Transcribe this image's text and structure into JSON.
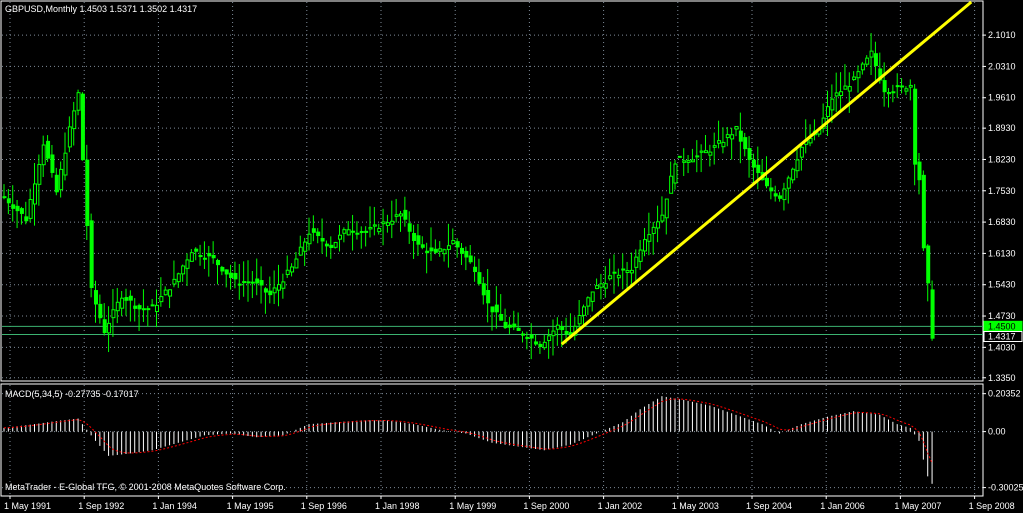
{
  "chart_data": [
    {
      "type": "candlestick",
      "title": "GBPUSD,Monthly  1.4503 1.5371 1.3502 1.4317",
      "y_ticks": [
        "2.1010",
        "2.0310",
        "1.9610",
        "1.8930",
        "1.8230",
        "1.7530",
        "1.6830",
        "1.6130",
        "1.5430",
        "1.4730",
        "1.4030",
        "1.3350"
      ],
      "y_tick_values": [
        2.101,
        2.031,
        1.961,
        1.893,
        1.823,
        1.753,
        1.683,
        1.613,
        1.543,
        1.473,
        1.403,
        1.335
      ],
      "ylim": [
        1.33,
        2.175
      ],
      "x_ticks": [
        "1 May 1991",
        "1 Sep 1992",
        "1 Jan 1994",
        "1 May 1995",
        "1 Sep 1996",
        "1 Jan 1998",
        "1 May 1999",
        "1 Sep 2000",
        "1 Jan 2002",
        "1 May 2003",
        "1 Sep 2004",
        "1 Jan 2006",
        "1 May 2007",
        "1 Sep 2008"
      ],
      "price_labels": [
        {
          "text": "1.4500",
          "value": 1.45,
          "color": "#00ff00"
        },
        {
          "text": "1.4317",
          "value": 1.4317,
          "color": "#ffffff"
        }
      ],
      "horizontal_lines": [
        {
          "value": 1.45,
          "color": "#3cb371"
        },
        {
          "value": 1.4317,
          "color": "#3cb371"
        }
      ],
      "trendline": {
        "from": {
          "date": "2001-11",
          "value": 1.41
        },
        "to": {
          "date": "2009-09",
          "value": 2.175
        },
        "color": "#ffff00"
      },
      "close_series": [
        {
          "date": "1991-03",
          "value": 1.74
        },
        {
          "date": "1991-08",
          "value": 1.69
        },
        {
          "date": "1991-12",
          "value": 1.86
        },
        {
          "date": "1992-03",
          "value": 1.75
        },
        {
          "date": "1992-06",
          "value": 1.89
        },
        {
          "date": "1992-08",
          "value": 1.97
        },
        {
          "date": "1992-11",
          "value": 1.53
        },
        {
          "date": "1993-02",
          "value": 1.44
        },
        {
          "date": "1993-06",
          "value": 1.52
        },
        {
          "date": "1993-10",
          "value": 1.49
        },
        {
          "date": "1994-01",
          "value": 1.49
        },
        {
          "date": "1994-06",
          "value": 1.55
        },
        {
          "date": "1994-10",
          "value": 1.62
        },
        {
          "date": "1995-03",
          "value": 1.6
        },
        {
          "date": "1995-08",
          "value": 1.55
        },
        {
          "date": "1995-12",
          "value": 1.55
        },
        {
          "date": "1996-04",
          "value": 1.52
        },
        {
          "date": "1996-09",
          "value": 1.58
        },
        {
          "date": "1997-01",
          "value": 1.66
        },
        {
          "date": "1997-06",
          "value": 1.63
        },
        {
          "date": "1997-10",
          "value": 1.67
        },
        {
          "date": "1998-02",
          "value": 1.66
        },
        {
          "date": "1998-06",
          "value": 1.68
        },
        {
          "date": "1998-10",
          "value": 1.7
        },
        {
          "date": "1999-02",
          "value": 1.63
        },
        {
          "date": "1999-06",
          "value": 1.61
        },
        {
          "date": "1999-10",
          "value": 1.64
        },
        {
          "date": "2000-03",
          "value": 1.58
        },
        {
          "date": "2000-06",
          "value": 1.5
        },
        {
          "date": "2000-10",
          "value": 1.45
        },
        {
          "date": "2001-03",
          "value": 1.43
        },
        {
          "date": "2001-06",
          "value": 1.41
        },
        {
          "date": "2001-10",
          "value": 1.45
        },
        {
          "date": "2002-01",
          "value": 1.43
        },
        {
          "date": "2002-06",
          "value": 1.53
        },
        {
          "date": "2002-10",
          "value": 1.56
        },
        {
          "date": "2003-03",
          "value": 1.58
        },
        {
          "date": "2003-06",
          "value": 1.65
        },
        {
          "date": "2003-10",
          "value": 1.7
        },
        {
          "date": "2004-01",
          "value": 1.82
        },
        {
          "date": "2004-06",
          "value": 1.83
        },
        {
          "date": "2004-10",
          "value": 1.85
        },
        {
          "date": "2005-03",
          "value": 1.89
        },
        {
          "date": "2005-06",
          "value": 1.82
        },
        {
          "date": "2005-10",
          "value": 1.76
        },
        {
          "date": "2006-01",
          "value": 1.74
        },
        {
          "date": "2006-06",
          "value": 1.85
        },
        {
          "date": "2006-10",
          "value": 1.89
        },
        {
          "date": "2007-01",
          "value": 1.96
        },
        {
          "date": "2007-06",
          "value": 2.0
        },
        {
          "date": "2007-10",
          "value": 2.06
        },
        {
          "date": "2008-01",
          "value": 1.98
        },
        {
          "date": "2008-04",
          "value": 1.98
        },
        {
          "date": "2008-07",
          "value": 1.99
        },
        {
          "date": "2008-08",
          "value": 1.82
        },
        {
          "date": "2008-09",
          "value": 1.78
        },
        {
          "date": "2008-10",
          "value": 1.62
        },
        {
          "date": "2008-11",
          "value": 1.54
        },
        {
          "date": "2008-12",
          "value": 1.43
        }
      ]
    },
    {
      "type": "histogram",
      "title": "MACD(5,34,5) -0.27735 -0.17017",
      "y_ticks": [
        "0.20352",
        "0.00",
        "-0.30025"
      ],
      "y_tick_values": [
        0.20352,
        0.0,
        -0.30025
      ],
      "ylim": [
        -0.34,
        0.25
      ],
      "macd_series": [
        {
          "date": "1991-03",
          "value": 0.02
        },
        {
          "date": "1991-10",
          "value": 0.04
        },
        {
          "date": "1992-04",
          "value": 0.06
        },
        {
          "date": "1992-08",
          "value": 0.07
        },
        {
          "date": "1992-12",
          "value": -0.05
        },
        {
          "date": "1993-03",
          "value": -0.13
        },
        {
          "date": "1993-07",
          "value": -0.12
        },
        {
          "date": "1994-01",
          "value": -0.1
        },
        {
          "date": "1994-07",
          "value": -0.06
        },
        {
          "date": "1995-01",
          "value": -0.02
        },
        {
          "date": "1995-07",
          "value": -0.01
        },
        {
          "date": "1996-01",
          "value": -0.03
        },
        {
          "date": "1996-07",
          "value": -0.02
        },
        {
          "date": "1997-01",
          "value": 0.04
        },
        {
          "date": "1997-07",
          "value": 0.05
        },
        {
          "date": "1998-01",
          "value": 0.06
        },
        {
          "date": "1998-07",
          "value": 0.06
        },
        {
          "date": "1999-01",
          "value": 0.04
        },
        {
          "date": "1999-07",
          "value": 0.01
        },
        {
          "date": "2000-01",
          "value": -0.01
        },
        {
          "date": "2000-07",
          "value": -0.06
        },
        {
          "date": "2001-01",
          "value": -0.08
        },
        {
          "date": "2001-07",
          "value": -0.1
        },
        {
          "date": "2002-01",
          "value": -0.07
        },
        {
          "date": "2002-07",
          "value": -0.01
        },
        {
          "date": "2003-01",
          "value": 0.05
        },
        {
          "date": "2003-05",
          "value": 0.12
        },
        {
          "date": "2003-10",
          "value": 0.19
        },
        {
          "date": "2004-03",
          "value": 0.17
        },
        {
          "date": "2004-09",
          "value": 0.14
        },
        {
          "date": "2005-03",
          "value": 0.09
        },
        {
          "date": "2005-09",
          "value": 0.04
        },
        {
          "date": "2006-01",
          "value": -0.01
        },
        {
          "date": "2006-06",
          "value": 0.04
        },
        {
          "date": "2006-12",
          "value": 0.08
        },
        {
          "date": "2007-06",
          "value": 0.11
        },
        {
          "date": "2007-12",
          "value": 0.09
        },
        {
          "date": "2008-04",
          "value": 0.04
        },
        {
          "date": "2008-07",
          "value": 0.02
        },
        {
          "date": "2008-09",
          "value": -0.05
        },
        {
          "date": "2008-10",
          "value": -0.15
        },
        {
          "date": "2008-11",
          "value": -0.24
        },
        {
          "date": "2008-12",
          "value": -0.28
        }
      ]
    }
  ],
  "footer_text": "MetaTrader - E-Global TFG, © 2001-2008 MetaQuotes Software Corp.",
  "colors": {
    "background": "#000000",
    "grid": "#7f8c99",
    "candle": "#00ff00",
    "macd_bars": "#ffffff",
    "signal_line": "#ff0000",
    "trendline": "#ffff00",
    "axis_text": "#ffffff"
  }
}
